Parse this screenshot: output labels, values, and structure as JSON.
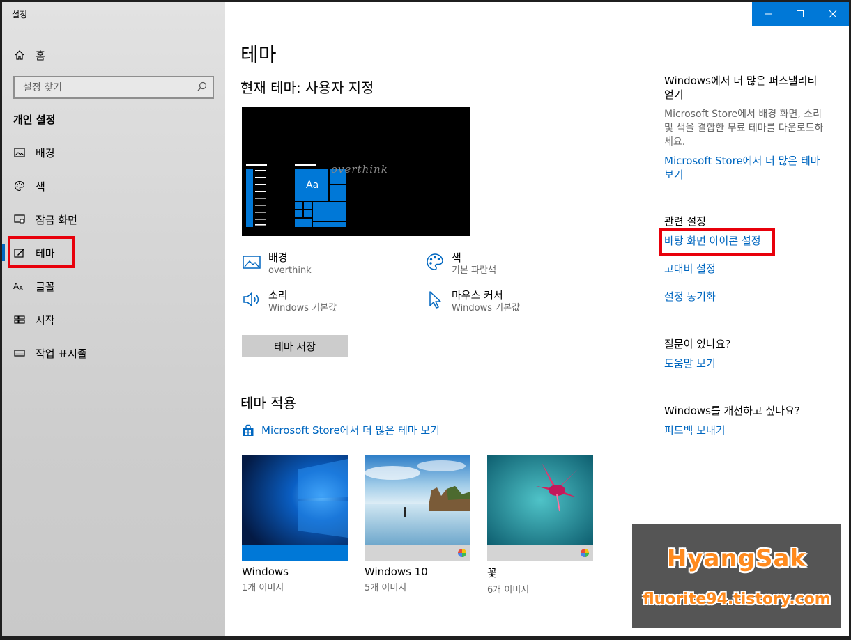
{
  "window": {
    "title": "설정"
  },
  "titlebar": {
    "minimize": "—",
    "maximize": "☐",
    "close": "✕"
  },
  "sidebar": {
    "home_label": "홈",
    "search_placeholder": "설정 찾기",
    "section_title": "개인 설정",
    "items": [
      {
        "label": "배경",
        "icon": "picture-icon"
      },
      {
        "label": "색",
        "icon": "palette-icon"
      },
      {
        "label": "잠금 화면",
        "icon": "lock-screen-icon"
      },
      {
        "label": "테마",
        "icon": "theme-icon",
        "active": true
      },
      {
        "label": "글꼴",
        "icon": "font-icon"
      },
      {
        "label": "시작",
        "icon": "start-icon"
      },
      {
        "label": "작업 표시줄",
        "icon": "taskbar-icon"
      }
    ]
  },
  "main": {
    "title": "테마",
    "current_theme": "현재 테마: 사용자 지정",
    "preview": {
      "tile_label": "Aa",
      "wallpaper_text": "overthink"
    },
    "properties": {
      "background": {
        "title": "배경",
        "value": "overthink"
      },
      "color": {
        "title": "색",
        "value": "기본 파란색"
      },
      "sound": {
        "title": "소리",
        "value": "Windows 기본값"
      },
      "cursor": {
        "title": "마우스 커서",
        "value": "Windows 기본값"
      }
    },
    "save_button": "테마 저장",
    "apply_title": "테마 적용",
    "store_link": "Microsoft Store에서 더 많은 테마 보기",
    "themes": [
      {
        "name": "Windows",
        "count": "1개 이미지"
      },
      {
        "name": "Windows 10",
        "count": "5개 이미지"
      },
      {
        "name": "꽃",
        "count": "6개 이미지"
      }
    ]
  },
  "right": {
    "personalize_title": "Windows에서 더 많은 퍼스낼리티 얻기",
    "personalize_desc": "Microsoft Store에서 배경 화면, 소리 및 색을 결합한 무료 테마를 다운로드하세요.",
    "personalize_link": "Microsoft Store에서 더 많은 테마 보기",
    "related_title": "관련 설정",
    "related_links": [
      "바탕 화면 아이콘 설정",
      "고대비 설정",
      "설정 동기화"
    ],
    "question_title": "질문이 있나요?",
    "help_link": "도움말 보기",
    "improve_title": "Windows를 개선하고 싶나요?",
    "feedback_link": "피드백 보내기"
  },
  "watermark": {
    "brand": "HyangSak",
    "url": "fluorite94.tistory.com"
  },
  "colors": {
    "accent": "#0078d7",
    "link": "#0067c0",
    "highlight": "#e8000b"
  }
}
